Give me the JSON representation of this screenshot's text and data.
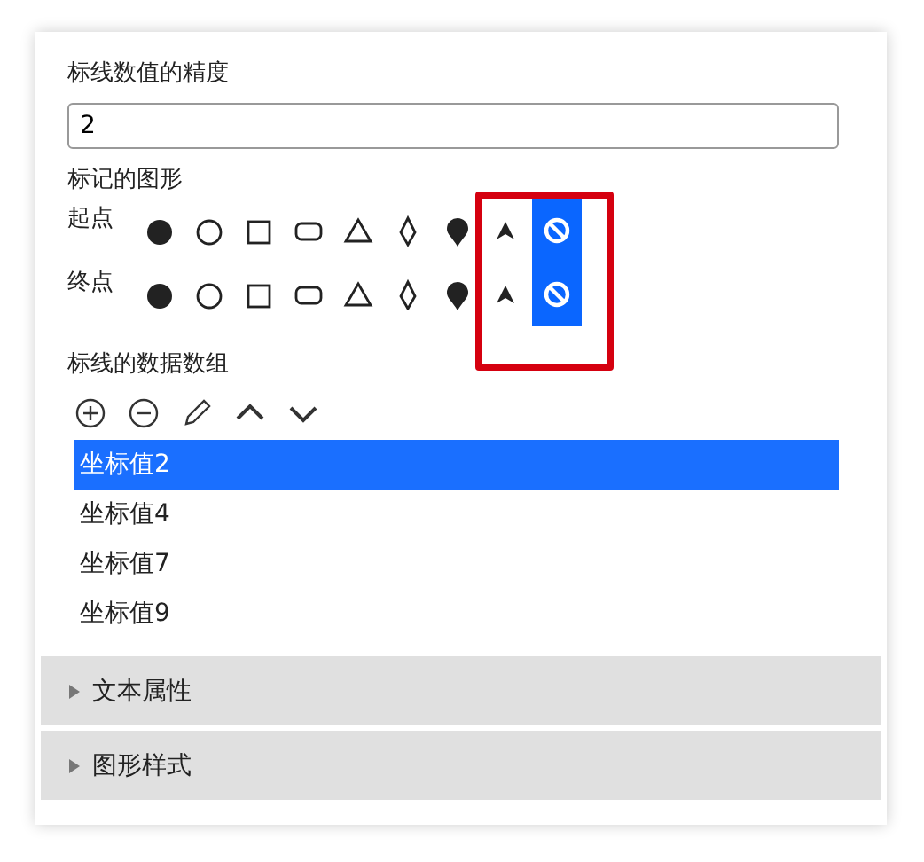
{
  "precision": {
    "label": "标线数值的精度",
    "value": "2"
  },
  "markers": {
    "label": "标记的图形",
    "rows": [
      {
        "label": "起点",
        "options": [
          {
            "kind": "dot",
            "selected": false
          },
          {
            "kind": "circle",
            "selected": false
          },
          {
            "kind": "square",
            "selected": false
          },
          {
            "kind": "roundrect",
            "selected": false
          },
          {
            "kind": "triangle",
            "selected": false
          },
          {
            "kind": "diamond",
            "selected": false
          },
          {
            "kind": "pin",
            "selected": false
          },
          {
            "kind": "arrow",
            "selected": false
          },
          {
            "kind": "none",
            "selected": true
          }
        ]
      },
      {
        "label": "终点",
        "options": [
          {
            "kind": "dot",
            "selected": false
          },
          {
            "kind": "circle",
            "selected": false
          },
          {
            "kind": "square",
            "selected": false
          },
          {
            "kind": "roundrect",
            "selected": false
          },
          {
            "kind": "triangle",
            "selected": false
          },
          {
            "kind": "diamond",
            "selected": false
          },
          {
            "kind": "pin",
            "selected": false
          },
          {
            "kind": "arrow",
            "selected": false
          },
          {
            "kind": "none",
            "selected": true
          }
        ]
      }
    ]
  },
  "data": {
    "label": "标线的数据数组",
    "tools": [
      {
        "kind": "add"
      },
      {
        "kind": "remove"
      },
      {
        "kind": "edit"
      },
      {
        "kind": "up"
      },
      {
        "kind": "down"
      }
    ],
    "items": [
      {
        "label": "坐标值2",
        "selected": true
      },
      {
        "label": "坐标值4",
        "selected": false
      },
      {
        "label": "坐标值7",
        "selected": false
      },
      {
        "label": "坐标值9",
        "selected": false
      }
    ]
  },
  "sections": [
    {
      "label": "文本属性",
      "expanded": false
    },
    {
      "label": "图形样式",
      "expanded": false
    }
  ]
}
